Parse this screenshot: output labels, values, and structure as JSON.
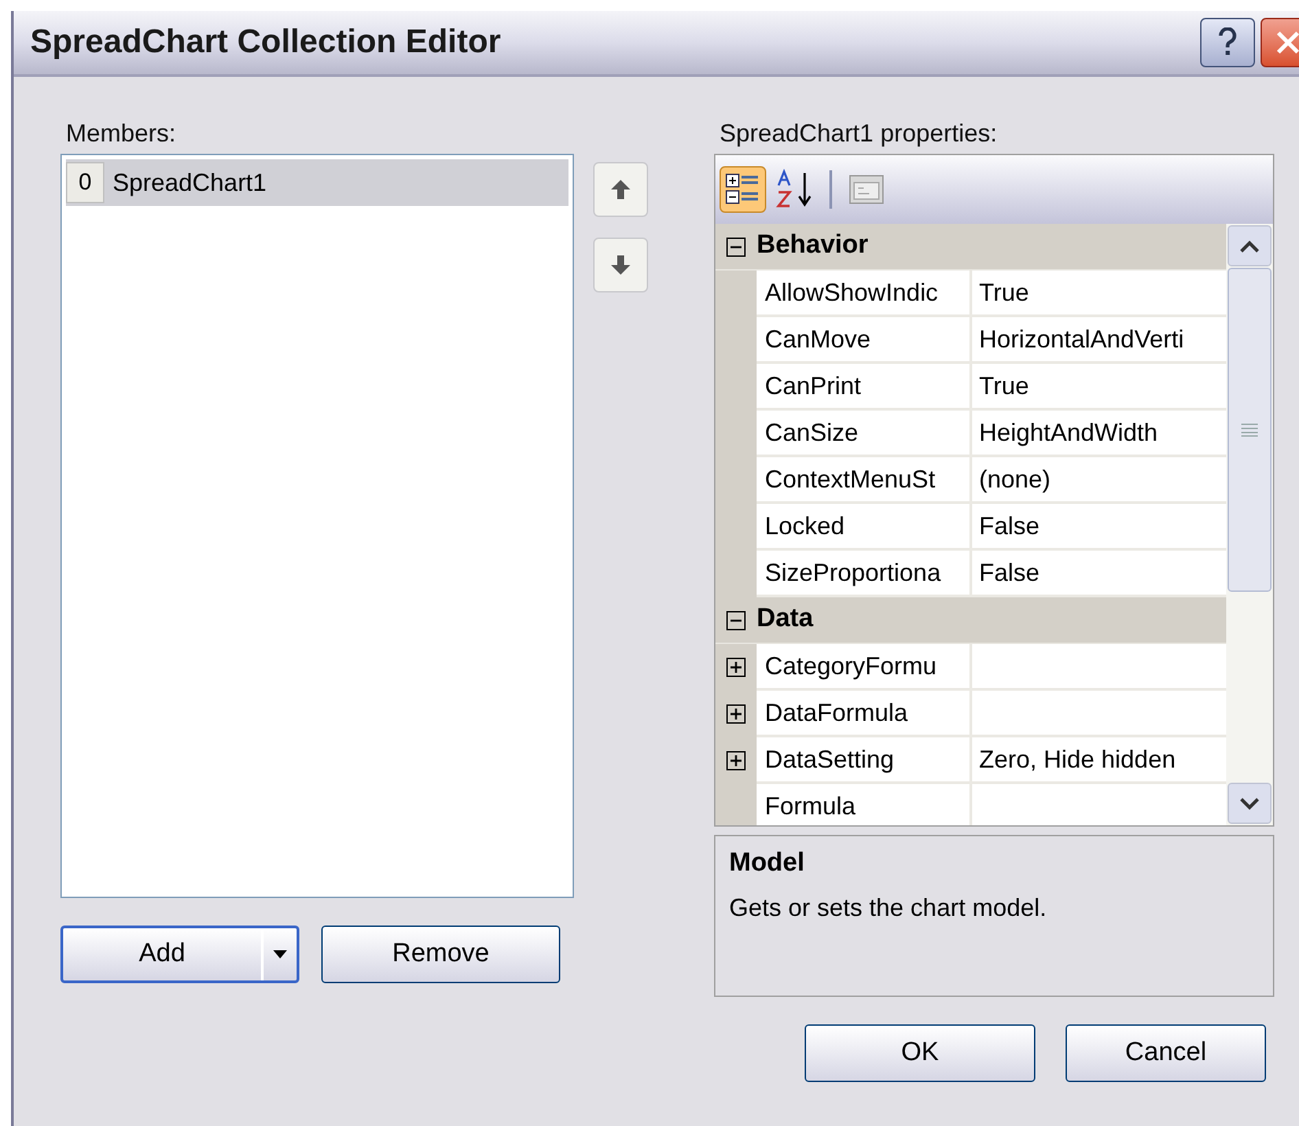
{
  "window": {
    "title": "SpreadChart Collection Editor"
  },
  "members": {
    "label": "Members:",
    "items": [
      {
        "index": "0",
        "name": "SpreadChart1",
        "selected": true
      }
    ]
  },
  "properties": {
    "label": "SpreadChart1 properties:",
    "toolbar": [
      {
        "kind": "categorized",
        "selected": true
      },
      {
        "kind": "alphabetical",
        "selected": false
      },
      {
        "kind": "pages",
        "selected": false
      }
    ],
    "rows": [
      {
        "kind": "category",
        "name": "Behavior",
        "expanded": true
      },
      {
        "kind": "property",
        "name": "AllowShowIndic",
        "value": "True"
      },
      {
        "kind": "property",
        "name": "CanMove",
        "value": "HorizontalAndVerti"
      },
      {
        "kind": "property",
        "name": "CanPrint",
        "value": "True"
      },
      {
        "kind": "property",
        "name": "CanSize",
        "value": "HeightAndWidth"
      },
      {
        "kind": "property",
        "name": "ContextMenuSt",
        "value": "(none)"
      },
      {
        "kind": "property",
        "name": "Locked",
        "value": "False"
      },
      {
        "kind": "property",
        "name": "SizeProportiona",
        "value": "False"
      },
      {
        "kind": "category",
        "name": "Data",
        "expanded": true
      },
      {
        "kind": "property",
        "name": "CategoryFormu",
        "expandable": true
      },
      {
        "kind": "property",
        "name": "DataFormula",
        "expandable": true
      },
      {
        "kind": "property",
        "name": "DataSetting",
        "value": "Zero, Hide hidden",
        "expandable": true
      },
      {
        "kind": "property",
        "name": "Formula"
      }
    ],
    "description": {
      "title": "Model",
      "text": "Gets or sets the chart model."
    }
  },
  "buttons": {
    "add": "Add",
    "remove": "Remove",
    "ok": "OK",
    "cancel": "Cancel"
  }
}
